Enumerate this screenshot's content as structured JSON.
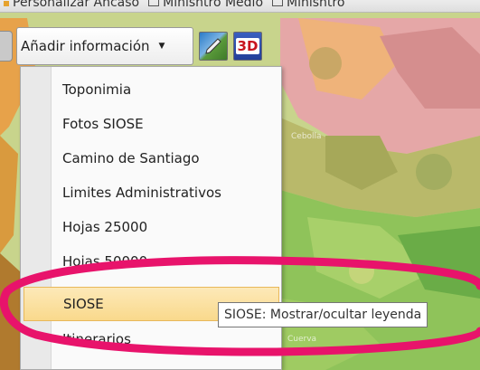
{
  "topbar": {
    "item1": "Personalizar Ancaso",
    "item2": "Minishtro Medio",
    "item3": "Minishtro"
  },
  "toolbar": {
    "dropdown_label": "Añadir información",
    "icon_2d": "map-2d-icon",
    "icon_3d_label": "3D"
  },
  "menu": {
    "items": [
      {
        "label": "Toponimia"
      },
      {
        "label": "Fotos SIOSE"
      },
      {
        "label": "Camino de Santiago"
      },
      {
        "label": "Limites Administrativos"
      },
      {
        "label": "Hojas 25000"
      },
      {
        "label": "Hojas 50000"
      },
      {
        "label": "SIOSE"
      },
      {
        "label": "Itinerarios"
      }
    ],
    "active_index": 6
  },
  "tooltip": {
    "text": "SIOSE: Mostrar/ocultar leyenda"
  },
  "map": {
    "labels": [
      "Cebolla",
      "Cuerva"
    ]
  },
  "colors": {
    "annotation": "#e8136b",
    "highlight": "#f9d98c"
  }
}
